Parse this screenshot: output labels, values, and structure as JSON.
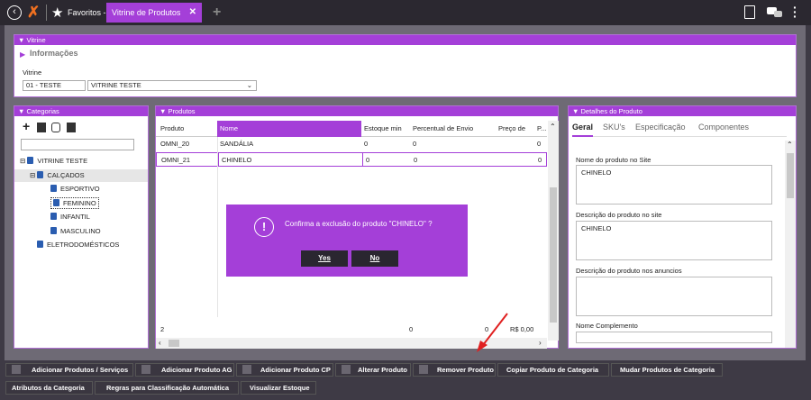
{
  "topbar": {
    "favoritos": "Favoritos -",
    "tab": "Vitrine de Produtos",
    "close": "✕",
    "add": "+"
  },
  "vitrine": {
    "header": "▼ Vitrine",
    "info_label": "Informações",
    "field_label": "Vitrine",
    "code": "01 - TESTE",
    "name": "VITRINE TESTE"
  },
  "categorias": {
    "header": "▼ Categorias",
    "items": [
      "VITRINE TESTE",
      "CALÇADOS",
      "ESPORTIVO",
      "FEMININO",
      "INFANTIL",
      "MASCULINO",
      "ELETRODOMÉSTICOS"
    ]
  },
  "produtos": {
    "header": "▼ Produtos",
    "columns": [
      "Produto",
      "Nome",
      "Estoque min",
      "Percentual de Envio",
      "Preço de",
      "P..."
    ],
    "rows": [
      [
        "OMNI_20",
        "SANDÁLIA",
        "0",
        "0",
        "",
        "0"
      ],
      [
        "OMNI_21",
        "CHINELO",
        "0",
        "0",
        "",
        "0"
      ]
    ],
    "footer": {
      "count": "2",
      "estoque": "0",
      "percentual": "0",
      "preco": "R$ 0,00"
    }
  },
  "dialog": {
    "message": "Confirma a exclusão do produto \"CHINELO\" ?",
    "yes": "Yes",
    "no": "No"
  },
  "detalhes": {
    "header": "▼ Detalhes do Produto",
    "tabs": [
      "Geral",
      "SKU's",
      "Especificação",
      "Componentes"
    ],
    "nome_site_label": "Nome do produto no Site",
    "nome_site_value": "CHINELO",
    "desc_site_label": "Descrição do produto no site",
    "desc_site_value": "CHINELO",
    "desc_anuncios_label": "Descrição do produto nos anuncios",
    "nome_comp_label": "Nome Complemento"
  },
  "buttons_row1": [
    "Adicionar Produtos / Serviços",
    "Adicionar Produto AG",
    "Adicionar Produto CP",
    "Alterar Produto",
    "Remover Produto",
    "Copiar Produto de Categoria",
    "Mudar Produtos de Categoria"
  ],
  "buttons_row2": [
    "Atributos da Categoria",
    "Regras para Classificação Automática",
    "Visualizar Estoque"
  ],
  "colors": {
    "accent": "#a43fd8",
    "dialog": "#a43fd8",
    "arrow": "#e02020"
  }
}
